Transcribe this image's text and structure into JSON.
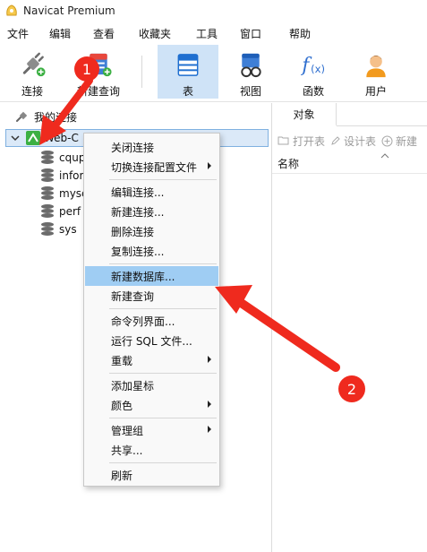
{
  "window": {
    "title": "Navicat Premium"
  },
  "menubar": [
    "文件",
    "编辑",
    "查看",
    "收藏夹",
    "工具",
    "窗口",
    "帮助"
  ],
  "toolbar": {
    "connect": "连接",
    "new_query": "新建查询",
    "table": "表",
    "view": "视图",
    "function": "函数",
    "user": "用户"
  },
  "tree": {
    "root": "我的连接",
    "connection": "Web-C",
    "databases": [
      "cqup",
      "infor",
      "mysc",
      "perf",
      "sys"
    ]
  },
  "object_panel": {
    "tab": "对象",
    "open_table": "打开表",
    "design_table": "设计表",
    "new_partial": "新建",
    "col_name": "名称"
  },
  "context_menu": {
    "close_conn": "关闭连接",
    "switch_profile": "切换连接配置文件",
    "edit_conn": "编辑连接...",
    "new_conn": "新建连接...",
    "delete_conn": "删除连接",
    "copy_conn": "复制连接...",
    "new_database": "新建数据库...",
    "new_query": "新建查询",
    "console": "命令列界面...",
    "run_sql": "运行 SQL 文件...",
    "reload": "重载",
    "add_star": "添加星标",
    "color": "颜色",
    "manage_group": "管理组",
    "share": "共享...",
    "refresh": "刷新"
  },
  "annotations": {
    "step1": "1",
    "step2": "2",
    "arrow_color": "#ef2a1e"
  },
  "colors": {
    "highlight": "#9fcdf3",
    "active_tab": "#cfe3f7",
    "accent": "#0f6fcf"
  }
}
